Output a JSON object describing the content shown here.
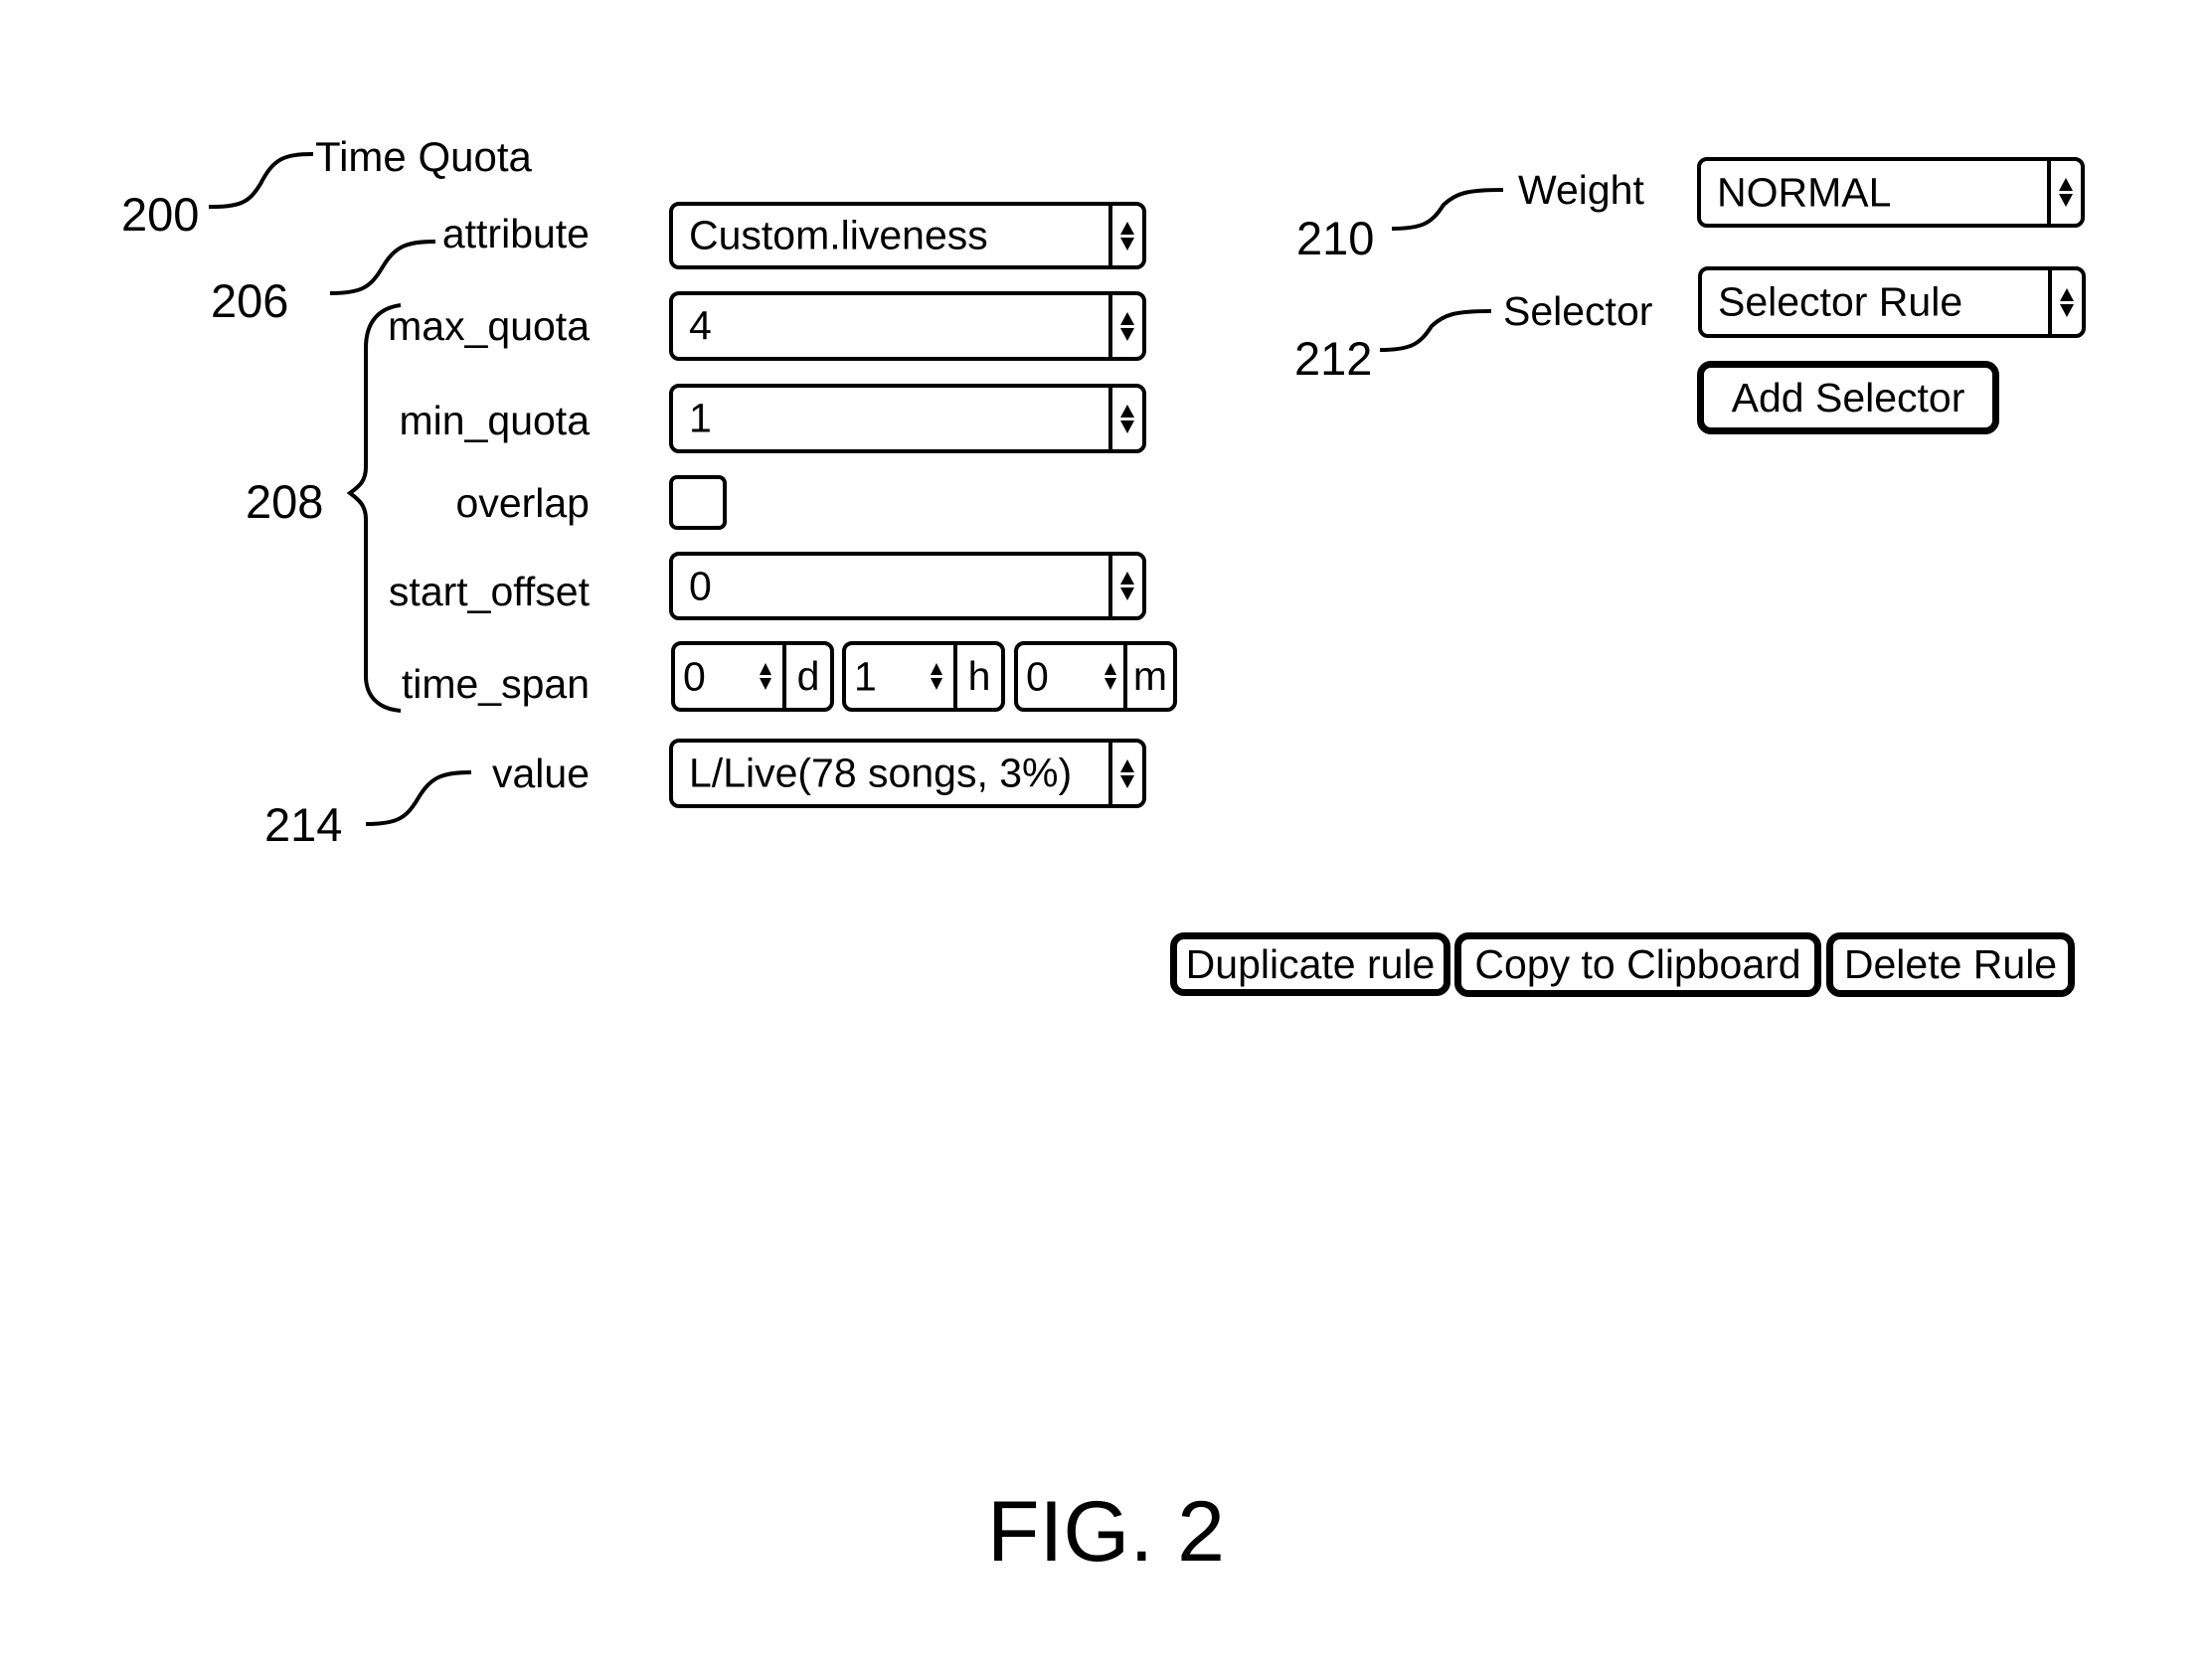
{
  "figure": {
    "caption": "FIG. 2"
  },
  "panel": {
    "title": "Time Quota",
    "ref_title": "200"
  },
  "refs": {
    "attribute": "206",
    "quota_group": "208",
    "weight": "210",
    "selector": "212",
    "value": "214"
  },
  "fields": {
    "attribute": {
      "label": "attribute",
      "value": "Custom.liveness"
    },
    "max_quota": {
      "label": "max_quota",
      "value": "4"
    },
    "min_quota": {
      "label": "min_quota",
      "value": "1"
    },
    "overlap": {
      "label": "overlap",
      "checked": false
    },
    "start_offset": {
      "label": "start_offset",
      "value": "0"
    },
    "time_span": {
      "label": "time_span",
      "days": {
        "value": "0",
        "unit": "d"
      },
      "hours": {
        "value": "1",
        "unit": "h"
      },
      "minutes": {
        "value": "0",
        "unit": "m"
      }
    },
    "value": {
      "label": "value",
      "value": "L/Live(78 songs, 3%)"
    },
    "weight": {
      "label": "Weight",
      "value": "NORMAL"
    },
    "selector": {
      "label": "Selector",
      "value": "Selector Rule"
    }
  },
  "buttons": {
    "add_selector": "Add Selector",
    "duplicate_rule": "Duplicate rule",
    "copy_to_clipboard": "Copy to Clipboard",
    "delete_rule": "Delete Rule"
  }
}
